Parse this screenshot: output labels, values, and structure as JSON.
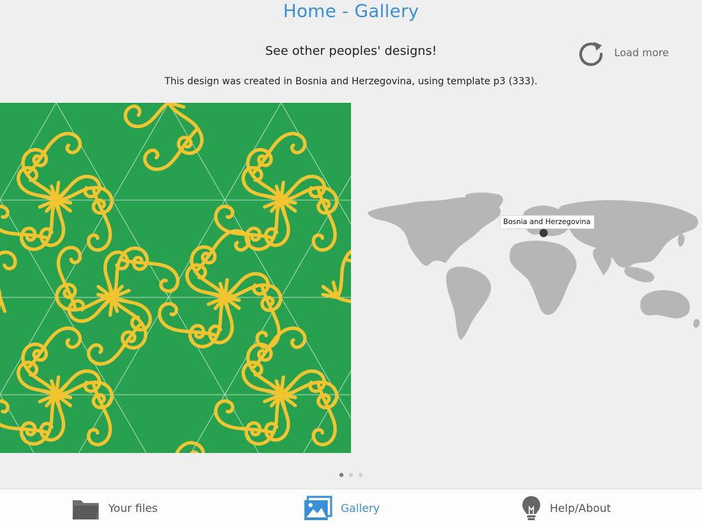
{
  "header": {
    "title": "Home - Gallery",
    "subtitle": "See other peoples' designs!",
    "load_more_label": "Load more"
  },
  "caption": "This design was created in Bosnia and Herzegovina, using template p3 (333).",
  "map": {
    "marker_label": "Bosnia and Herzegovina"
  },
  "design": {
    "background_color": "#27a150",
    "stroke_color": "#f2c530"
  },
  "pager": {
    "page_count": 3,
    "current_page": 1
  },
  "tabbar": {
    "tabs": [
      {
        "label": "Your files",
        "icon": "folder-icon",
        "active": false
      },
      {
        "label": "Gallery",
        "icon": "gallery-icon",
        "active": true
      },
      {
        "label": "Help/About",
        "icon": "lightbulb-icon",
        "active": false
      }
    ]
  },
  "colors": {
    "accent": "#3a8fd6",
    "map_land": "#b6b6b6"
  }
}
